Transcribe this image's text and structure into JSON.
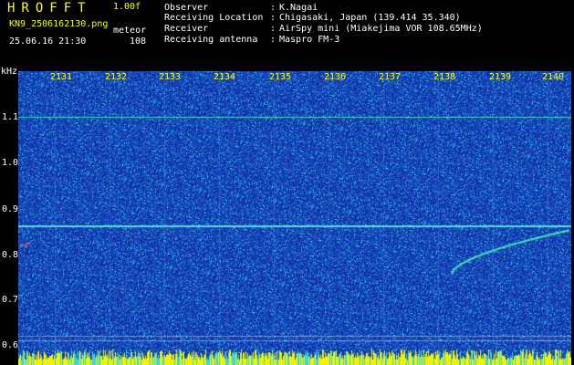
{
  "header": {
    "app_title": "HROFFT",
    "version": "1.00f",
    "file_name": "KN9_2506162130.png",
    "event_label": "meteor",
    "timestamp": "25.06.16 21:30",
    "event_count": "108"
  },
  "info": [
    {
      "key": "Observer",
      "value": "K.Nagai"
    },
    {
      "key": "Receiving Location",
      "value": "Chigasaki, Japan (139.414 35.340)"
    },
    {
      "key": "Receiver",
      "value": "AirSpy mini (Miakejima VOR 108.65MHz)"
    },
    {
      "key": "Receiving antenna",
      "value": "Maspro FM-3"
    }
  ],
  "axis": {
    "unit": "kHz",
    "y_ticks": [
      "1.1",
      "1.0",
      "0.9",
      "0.8",
      "0.7",
      "0.6"
    ],
    "x_ticks": [
      "2131",
      "2132",
      "2133",
      "2134",
      "2135",
      "2136",
      "2137",
      "2138",
      "2139",
      "2140"
    ]
  },
  "colors": {
    "background": "#000000",
    "noise_base": "#1b2f9b",
    "signal": "#3fe0b0",
    "label_yellow": "#ffff00",
    "label_white": "#ffffff"
  }
}
